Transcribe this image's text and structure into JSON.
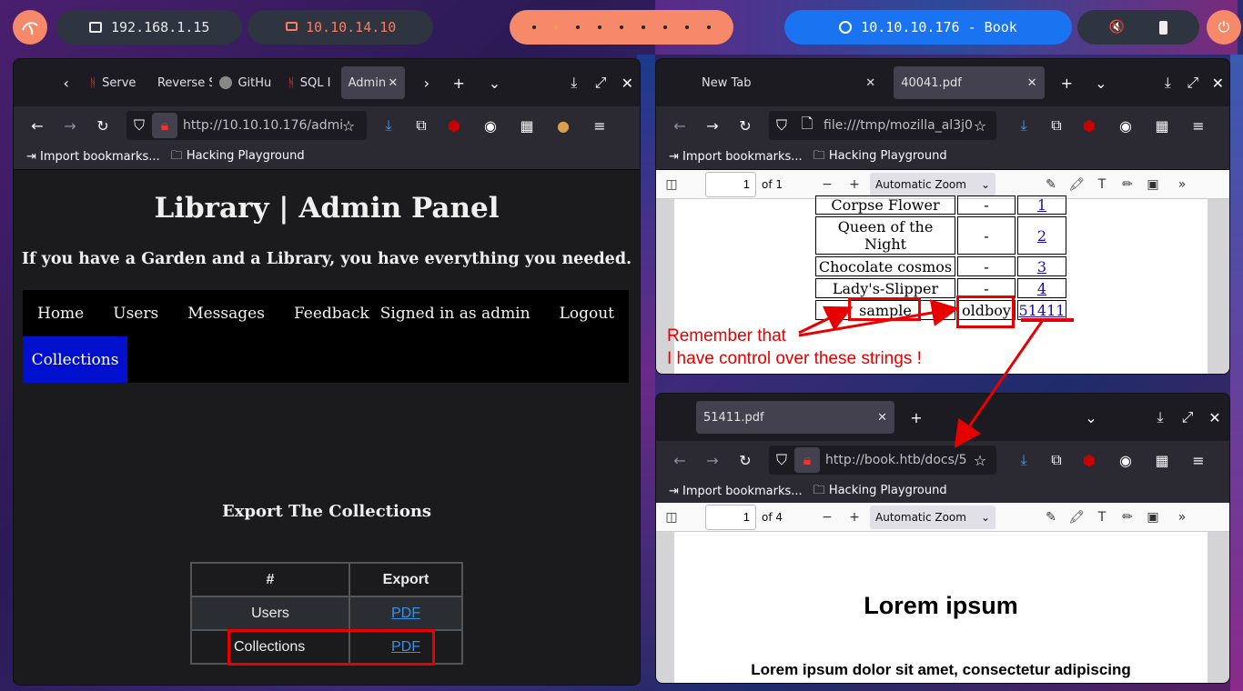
{
  "topbar": {
    "ip_local": "192.168.1.15",
    "ip_vpn": "10.10.14.10",
    "target": "10.10.10.176 - Book",
    "colors": {
      "accent_blue": "#1a73f0",
      "accent_orange": "#f5896a",
      "vpn_text": "#ff7a5c"
    }
  },
  "left_window": {
    "tabs": [
      "Serve",
      "Reverse S",
      "GitHu",
      "SQL I",
      "Admin"
    ],
    "url": "http://10.10.10.176/admi",
    "bookmarks": [
      "Import bookmarks...",
      "Hacking Playground"
    ],
    "page": {
      "title": "Library | Admin Panel",
      "subtitle": "If you have a Garden and a Library, you have everything you needed.",
      "nav": [
        "Home",
        "Users",
        "Messages",
        "Feedback"
      ],
      "nav_right": [
        "Signed in as admin",
        "Logout"
      ],
      "nav_active": "Collections",
      "section_title": "Export The Collections",
      "table": {
        "headers": [
          "#",
          "Export"
        ],
        "rows": [
          {
            "name": "Users",
            "link": "PDF"
          },
          {
            "name": "Collections",
            "link": "PDF"
          }
        ]
      }
    }
  },
  "right_top_window": {
    "tabs": [
      "New Tab",
      "40041.pdf"
    ],
    "url": "file:///tmp/mozilla_al3j0",
    "bookmarks": [
      "Import bookmarks...",
      "Hacking Playground"
    ],
    "pdf": {
      "page": "1",
      "of": "of 1",
      "zoom": "Automatic Zoom"
    },
    "doc_rows": [
      [
        "Corpse Flower",
        "-",
        "1"
      ],
      [
        "Queen of the Night",
        "-",
        "2"
      ],
      [
        "Chocolate cosmos",
        "-",
        "3"
      ],
      [
        "Lady's-Slipper",
        "-",
        "4"
      ],
      [
        "sample",
        "oldboy",
        "51411"
      ]
    ],
    "annotation": {
      "line1": "Remember that",
      "line2": "I have control over these strings !"
    }
  },
  "right_bottom_window": {
    "tabs": [
      "51411.pdf"
    ],
    "url": "http://book.htb/docs/5",
    "bookmarks": [
      "Import bookmarks...",
      "Hacking Playground"
    ],
    "pdf": {
      "page": "1",
      "of": "of 4",
      "zoom": "Automatic Zoom"
    },
    "doc": {
      "heading": "Lorem ipsum",
      "line": "Lorem ipsum dolor sit amet, consectetur adipiscing"
    }
  }
}
